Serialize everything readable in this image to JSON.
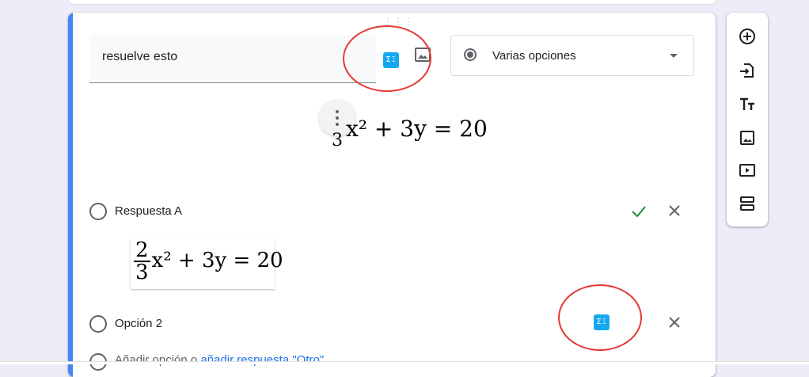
{
  "question": {
    "title_value": "resuelve esto",
    "math_button_label": "Σ𝙸",
    "type_select": {
      "selected": "Varias opciones"
    },
    "equation": {
      "lead": "3",
      "expression": "x² + 3y = 20"
    }
  },
  "options": [
    {
      "label": "Respuesta A",
      "correct": true,
      "image_equation": {
        "numerator": "2",
        "denominator": "3",
        "rest": "x² + 3y = 20"
      }
    },
    {
      "label": "Opción 2",
      "math_button_label": "Σ𝙸"
    }
  ],
  "add_option": {
    "text": "Añadir opción",
    "separator": "o",
    "link": "añadir respuesta \"Otro\""
  },
  "toolbar": {
    "icons": [
      "add-question-icon",
      "import-questions-icon",
      "add-title-icon",
      "add-image-icon",
      "add-video-icon",
      "add-section-icon"
    ]
  },
  "colors": {
    "accent": "#4285f4",
    "background": "#f0ebf8",
    "math_button": "#15a8ef",
    "annotation": "#e53935",
    "check": "#1e8e3e"
  }
}
